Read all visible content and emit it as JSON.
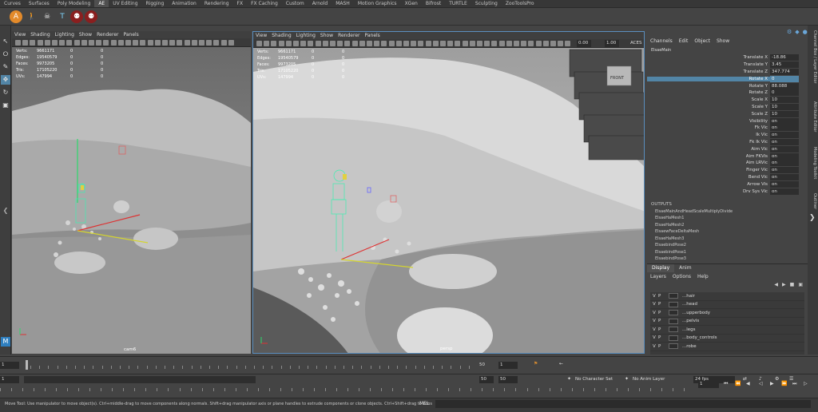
{
  "shelf_tabs": [
    "Curves",
    "Surfaces",
    "Poly Modeling",
    "AE",
    "UV Editing",
    "Rigging",
    "Animation",
    "Rendering",
    "FX",
    "FX Caching",
    "Custom",
    "Arnold",
    "MASH",
    "Motion Graphics",
    "XGen",
    "Bifrost",
    "TURTLE",
    "Sculpting",
    "ZooToolsPro"
  ],
  "active_shelf_tab": "AE",
  "shelf_icons": [
    "a-logo-icon",
    "human-figure-icon",
    "skull-icon",
    "t-pose-icon",
    "rig-icon",
    "rig-icon"
  ],
  "viewport_menu": [
    "View",
    "Shading",
    "Lighting",
    "Show",
    "Renderer",
    "Panels"
  ],
  "viewport_left": {
    "hud": [
      {
        "label": "Verts:",
        "value": "9661171",
        "z1": "0",
        "z2": "0"
      },
      {
        "label": "Edges:",
        "value": "19540579",
        "z1": "0",
        "z2": "0"
      },
      {
        "label": "Faces:",
        "value": "9973205",
        "z1": "0",
        "z2": "0"
      },
      {
        "label": "Tris:",
        "value": "17105220",
        "z1": "0",
        "z2": "0"
      },
      {
        "label": "UVs:",
        "value": "147994",
        "z1": "0",
        "z2": "0"
      }
    ],
    "camera_label": "cam6"
  },
  "viewport_right": {
    "hud": [
      {
        "label": "Verts:",
        "value": "9661171",
        "z1": "0",
        "z2": "0"
      },
      {
        "label": "Edges:",
        "value": "19540579",
        "z1": "0",
        "z2": "0"
      },
      {
        "label": "Faces:",
        "value": "9973205",
        "z1": "0",
        "z2": "0"
      },
      {
        "label": "Tris:",
        "value": "17105220",
        "z1": "0",
        "z2": "0"
      },
      {
        "label": "UVs:",
        "value": "147994",
        "z1": "0",
        "z2": "0"
      }
    ],
    "camera_label": "persp",
    "exposure": "0.00",
    "gamma": "1.00",
    "colorspace": "ACES",
    "view_cube_label": "FRONT"
  },
  "channel_box": {
    "menu": [
      "Channels",
      "Edit",
      "Object",
      "Show"
    ],
    "object_name": "ElsaeMain",
    "attributes": [
      {
        "name": "Translate X",
        "value": "-18.86"
      },
      {
        "name": "Translate Y",
        "value": "3.45"
      },
      {
        "name": "Translate Z",
        "value": "347.774"
      },
      {
        "name": "Rotate X",
        "value": "0",
        "selected": true
      },
      {
        "name": "Rotate Y",
        "value": "88.088"
      },
      {
        "name": "Rotate Z",
        "value": "0"
      },
      {
        "name": "Scale X",
        "value": "10"
      },
      {
        "name": "Scale Y",
        "value": "10"
      },
      {
        "name": "Scale Z",
        "value": "10"
      },
      {
        "name": "Visibility",
        "value": "on"
      },
      {
        "name": "Fk Vic",
        "value": "on"
      },
      {
        "name": "Ik Vic",
        "value": "on"
      },
      {
        "name": "Fk Ik Vic",
        "value": "on"
      },
      {
        "name": "Aim Vic",
        "value": "on"
      },
      {
        "name": "Aim FKVis",
        "value": "on"
      },
      {
        "name": "Aim LRVic",
        "value": "on"
      },
      {
        "name": "Finger Vic",
        "value": "on"
      },
      {
        "name": "Bend Vic",
        "value": "on"
      },
      {
        "name": "Arrow Vis",
        "value": "on"
      },
      {
        "name": "Drv Sys Vic",
        "value": "on"
      }
    ],
    "outputs_label": "OUTPUTS",
    "outputs": [
      "ElsaeMainAndHeadScaleMultiplyDivide",
      "ElsaeHaMesh1",
      "ElsaeHaMesh2",
      "ElsaewFaceDeltaMesh",
      "ElsaeHaMesh3",
      "ElsaebindPose2",
      "ElsaebindPose1",
      "ElsaebindPose3"
    ]
  },
  "right_tabs": [
    "Channel Box / Layer Editor",
    "Attribute Editor",
    "Modeling Toolkit",
    "Outliner"
  ],
  "layer_editor": {
    "tabs": [
      "Display",
      "Anim"
    ],
    "active_tab": "Display",
    "menu": [
      "Layers",
      "Options",
      "Help"
    ],
    "layers": [
      {
        "v": "V",
        "p": "P",
        "name": "...hair"
      },
      {
        "v": "V",
        "p": "P",
        "name": "...head"
      },
      {
        "v": "V",
        "p": "P",
        "name": "...upperbody"
      },
      {
        "v": "V",
        "p": "P",
        "name": "...pelvis"
      },
      {
        "v": "V",
        "p": "P",
        "name": "...legs"
      },
      {
        "v": "V",
        "p": "P",
        "name": "...body_controls"
      },
      {
        "v": "V",
        "p": "P",
        "name": "...robe"
      }
    ]
  },
  "time_slider": {
    "start": "1",
    "current_frame": "1",
    "end_label": "50"
  },
  "range_slider": {
    "start": "1",
    "start2": "1",
    "end": "50",
    "end2": "50",
    "character_set": "No Character Set",
    "anim_layer": "No Anim Layer",
    "fps": "24 fps",
    "frame_field": "1"
  },
  "help_line": {
    "message": "Move Tool: Use manipulator to move object(s). Ctrl+middle-drag to move components along normals. Shift+drag manipulator axis or plane handles to extrude components or clone objects. Ctrl+Shift+drag to cons",
    "mel_label": "MEL"
  },
  "colors": {
    "selected": "#5285a6",
    "panel": "#444444",
    "viewport_border": "#5b8fbf"
  }
}
